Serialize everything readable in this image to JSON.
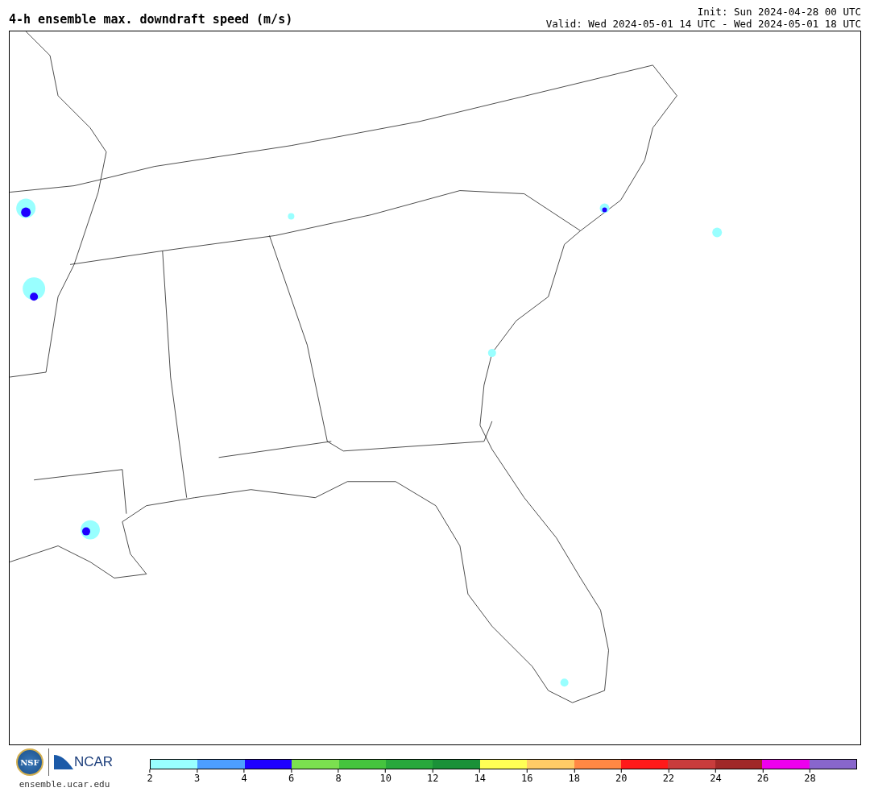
{
  "title": "4-h ensemble max. downdraft speed (m/s)",
  "init": "Init: Sun 2024-04-28 00 UTC",
  "valid": "Valid: Wed 2024-05-01 14 UTC - Wed 2024-05-01 18 UTC",
  "logos": {
    "nsf": "NSF",
    "ncar": "NCAR",
    "url": "ensemble.ucar.edu"
  },
  "colorbar": {
    "segments": [
      {
        "color": "#99ffff"
      },
      {
        "color": "#4d9eff"
      },
      {
        "color": "#1f00ff"
      },
      {
        "color": "#7be04f"
      },
      {
        "color": "#45c43e"
      },
      {
        "color": "#28a83c"
      },
      {
        "color": "#1a9138"
      },
      {
        "color": "#ffff55"
      },
      {
        "color": "#ffcc66"
      },
      {
        "color": "#ff8844"
      },
      {
        "color": "#ff1a1a"
      },
      {
        "color": "#c83c3c"
      },
      {
        "color": "#a02828"
      },
      {
        "color": "#ee00ee"
      },
      {
        "color": "#8866cc"
      }
    ],
    "ticks": [
      "2",
      "3",
      "4",
      "6",
      "8",
      "10",
      "12",
      "14",
      "16",
      "18",
      "20",
      "22",
      "24",
      "26",
      "28"
    ]
  }
}
